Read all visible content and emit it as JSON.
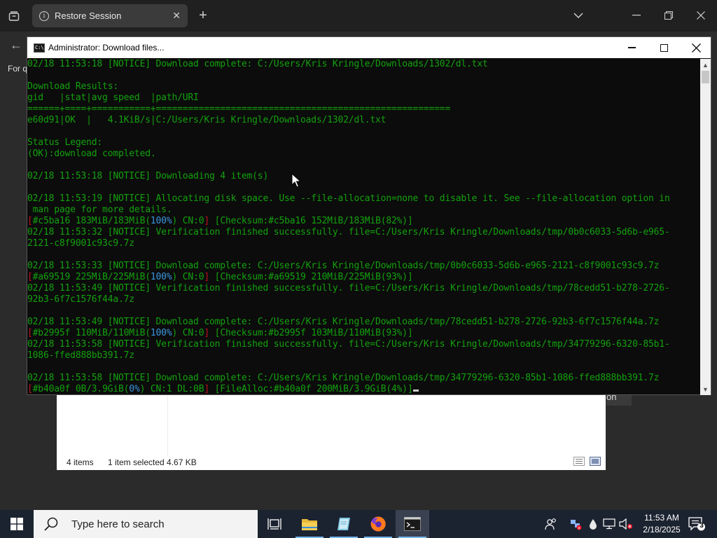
{
  "browser": {
    "tab_title": "Restore Session",
    "content_text": "For q",
    "pill_text": "on"
  },
  "console": {
    "title": "Administrator:  Download files...",
    "lines": [
      [
        {
          "t": "02/18 11:53:18 [NOTICE] Download complete: C:/Users/Kris Kringle/Downloads/1302/dl.txt"
        }
      ],
      [
        {
          "t": ""
        }
      ],
      [
        {
          "t": "Download Results:"
        }
      ],
      [
        {
          "t": "gid   |stat|avg speed  |path/URI"
        }
      ],
      [
        {
          "t": "======+====+===========+======================================================="
        }
      ],
      [
        {
          "t": "e60d91|OK  |   4.1KiB/s|C:/Users/Kris Kringle/Downloads/1302/dl.txt"
        }
      ],
      [
        {
          "t": ""
        }
      ],
      [
        {
          "t": "Status Legend:"
        }
      ],
      [
        {
          "t": "(OK):download completed."
        }
      ],
      [
        {
          "t": ""
        }
      ],
      [
        {
          "t": "02/18 11:53:18 [NOTICE] Downloading 4 item(s)"
        }
      ],
      [
        {
          "t": ""
        }
      ],
      [
        {
          "t": "02/18 11:53:19 [NOTICE] Allocating disk space. Use --file-allocation=none to disable it. See --file-allocation option in"
        }
      ],
      [
        {
          "t": " man page for more details."
        }
      ],
      [
        {
          "t": "[",
          "c": "red"
        },
        {
          "t": "#c5ba16 183MiB/183MiB("
        },
        {
          "t": "100%",
          "c": "cyan"
        },
        {
          "t": ") CN:0"
        },
        {
          "t": "]",
          "c": "red"
        },
        {
          "t": " [Checksum:#c5ba16 152MiB/183MiB(82%)]"
        }
      ],
      [
        {
          "t": "02/18 11:53:32 [NOTICE] Verification finished successfully. file=C:/Users/Kris Kringle/Downloads/tmp/0b0c6033-5d6b-e965-"
        }
      ],
      [
        {
          "t": "2121-c8f9001c93c9.7z"
        }
      ],
      [
        {
          "t": ""
        }
      ],
      [
        {
          "t": "02/18 11:53:33 [NOTICE] Download complete: C:/Users/Kris Kringle/Downloads/tmp/0b0c6033-5d6b-e965-2121-c8f9001c93c9.7z"
        }
      ],
      [
        {
          "t": "[",
          "c": "red"
        },
        {
          "t": "#a69519 225MiB/225MiB("
        },
        {
          "t": "100%",
          "c": "cyan"
        },
        {
          "t": ") CN:0"
        },
        {
          "t": "]",
          "c": "red"
        },
        {
          "t": " [Checksum:#a69519 210MiB/225MiB(93%)]"
        }
      ],
      [
        {
          "t": "02/18 11:53:49 [NOTICE] Verification finished successfully. file=C:/Users/Kris Kringle/Downloads/tmp/78cedd51-b278-2726-"
        }
      ],
      [
        {
          "t": "92b3-6f7c1576f44a.7z"
        }
      ],
      [
        {
          "t": ""
        }
      ],
      [
        {
          "t": "02/18 11:53:49 [NOTICE] Download complete: C:/Users/Kris Kringle/Downloads/tmp/78cedd51-b278-2726-92b3-6f7c1576f44a.7z"
        }
      ],
      [
        {
          "t": "[",
          "c": "red"
        },
        {
          "t": "#b2995f 110MiB/110MiB("
        },
        {
          "t": "100%",
          "c": "cyan"
        },
        {
          "t": ") CN:0"
        },
        {
          "t": "]",
          "c": "red"
        },
        {
          "t": " [Checksum:#b2995f 103MiB/110MiB(93%)]"
        }
      ],
      [
        {
          "t": "02/18 11:53:58 [NOTICE] Verification finished successfully. file=C:/Users/Kris Kringle/Downloads/tmp/34779296-6320-85b1-"
        }
      ],
      [
        {
          "t": "1086-ffed888bb391.7z"
        }
      ],
      [
        {
          "t": ""
        }
      ],
      [
        {
          "t": "02/18 11:53:58 [NOTICE] Download complete: C:/Users/Kris Kringle/Downloads/tmp/34779296-6320-85b1-1086-ffed888bb391.7z"
        }
      ],
      [
        {
          "t": "[",
          "c": "red"
        },
        {
          "t": "#b40a0f 0B/3.9GiB("
        },
        {
          "t": "0%",
          "c": "cyan"
        },
        {
          "t": ") CN:1 DL:0B"
        },
        {
          "t": "]",
          "c": "red"
        },
        {
          "t": " [FileAlloc:#b40a0f 200MiB/3.9GiB(4%)]",
          "cursor": true
        }
      ]
    ]
  },
  "explorer": {
    "items_count": "4 items",
    "selected": "1 item selected  4.67 KB"
  },
  "taskbar": {
    "search_placeholder": "Type here to search",
    "time": "11:53 AM",
    "date": "2/18/2025",
    "notification_count": "3"
  },
  "colors": {
    "console_green": "#13a10e",
    "console_red": "#c50f1f",
    "console_cyan": "#3a96dd",
    "taskbar": "#1c2330",
    "accent": "#76b9ed"
  }
}
